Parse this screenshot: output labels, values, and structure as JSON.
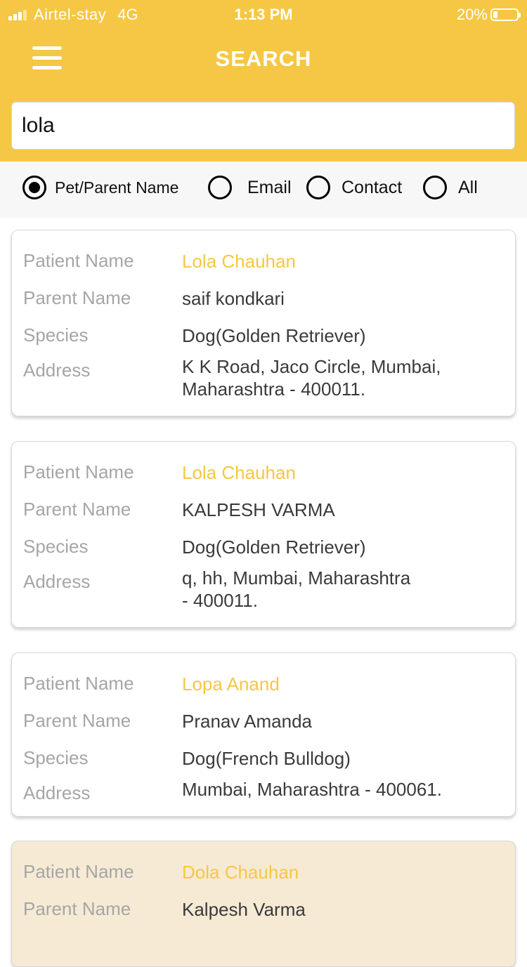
{
  "status_bar": {
    "carrier": "Airtel-stay",
    "network": "4G",
    "time": "1:13 PM",
    "battery_percent": "20%",
    "battery_level": 0.2
  },
  "header": {
    "title": "SEARCH",
    "menu_icon": "hamburger-menu-icon"
  },
  "search": {
    "value": "lola",
    "placeholder": ""
  },
  "filters": {
    "options": [
      {
        "label": "Pet/Parent Name",
        "selected": true
      },
      {
        "label": "Email",
        "selected": false
      },
      {
        "label": "Contact",
        "selected": false
      },
      {
        "label": "All",
        "selected": false
      }
    ]
  },
  "labels": {
    "patient_name": "Patient Name",
    "parent_name": "Parent Name",
    "species": "Species",
    "address": "Address"
  },
  "results": [
    {
      "patient_name": "Lola Chauhan",
      "parent_name": "saif kondkari",
      "species": "Dog(Golden Retriever)",
      "address_line1": "K K Road, Jaco Circle, Mumbai,",
      "address_line2": "Maharashtra - 400011."
    },
    {
      "patient_name": "Lola Chauhan",
      "parent_name": "KALPESH VARMA",
      "species": "Dog(Golden Retriever)",
      "address_line1": "q, hh, Mumbai, Maharashtra",
      "address_line2": "- 400011."
    },
    {
      "patient_name": "Lopa Anand",
      "parent_name": "Pranav Amanda",
      "species": "Dog(French Bulldog)",
      "address_line1": "Mumbai, Maharashtra - 400061.",
      "address_line2": ""
    },
    {
      "patient_name": "Dola Chauhan",
      "parent_name": "Kalpesh Varma",
      "species": "",
      "address_line1": "",
      "address_line2": ""
    }
  ],
  "colors": {
    "accent": "#f6c744",
    "label": "#a6a6a6",
    "value": "#3a3a3a",
    "selected_card": "#f6ead5"
  }
}
